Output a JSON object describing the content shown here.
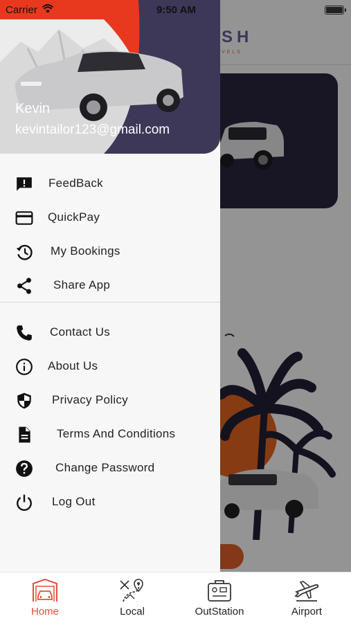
{
  "status_bar": {
    "carrier": "Carrier",
    "time": "9:50 AM"
  },
  "background": {
    "logo": "SH",
    "logo_sub": "VELS"
  },
  "drawer": {
    "user_name": "Kevin",
    "user_email": "kevintailor123@gmail.com",
    "menu_primary": [
      {
        "label": "FeedBack",
        "icon": "feedback-icon"
      },
      {
        "label": "QuickPay",
        "icon": "credit-card-icon"
      },
      {
        "label": "My Bookings",
        "icon": "history-icon"
      },
      {
        "label": "Share App",
        "icon": "share-icon"
      }
    ],
    "menu_secondary": [
      {
        "label": "Contact Us",
        "icon": "phone-icon"
      },
      {
        "label": "About Us",
        "icon": "info-icon"
      },
      {
        "label": "Privacy Policy",
        "icon": "shield-icon"
      },
      {
        "label": "Terms And Conditions",
        "icon": "document-icon"
      },
      {
        "label": "Change Password",
        "icon": "help-icon"
      },
      {
        "label": "Log Out",
        "icon": "power-icon"
      }
    ]
  },
  "tab_bar": {
    "active": "Home",
    "tabs": [
      {
        "label": "Home",
        "icon": "garage-car-icon"
      },
      {
        "label": "Local",
        "icon": "route-pin-icon"
      },
      {
        "label": "OutStation",
        "icon": "suitcase-icon"
      },
      {
        "label": "Airport",
        "icon": "airplane-icon"
      }
    ]
  },
  "colors": {
    "accent": "#e2503a",
    "header_dark": "#3d3858",
    "header_red": "#e8391f"
  }
}
